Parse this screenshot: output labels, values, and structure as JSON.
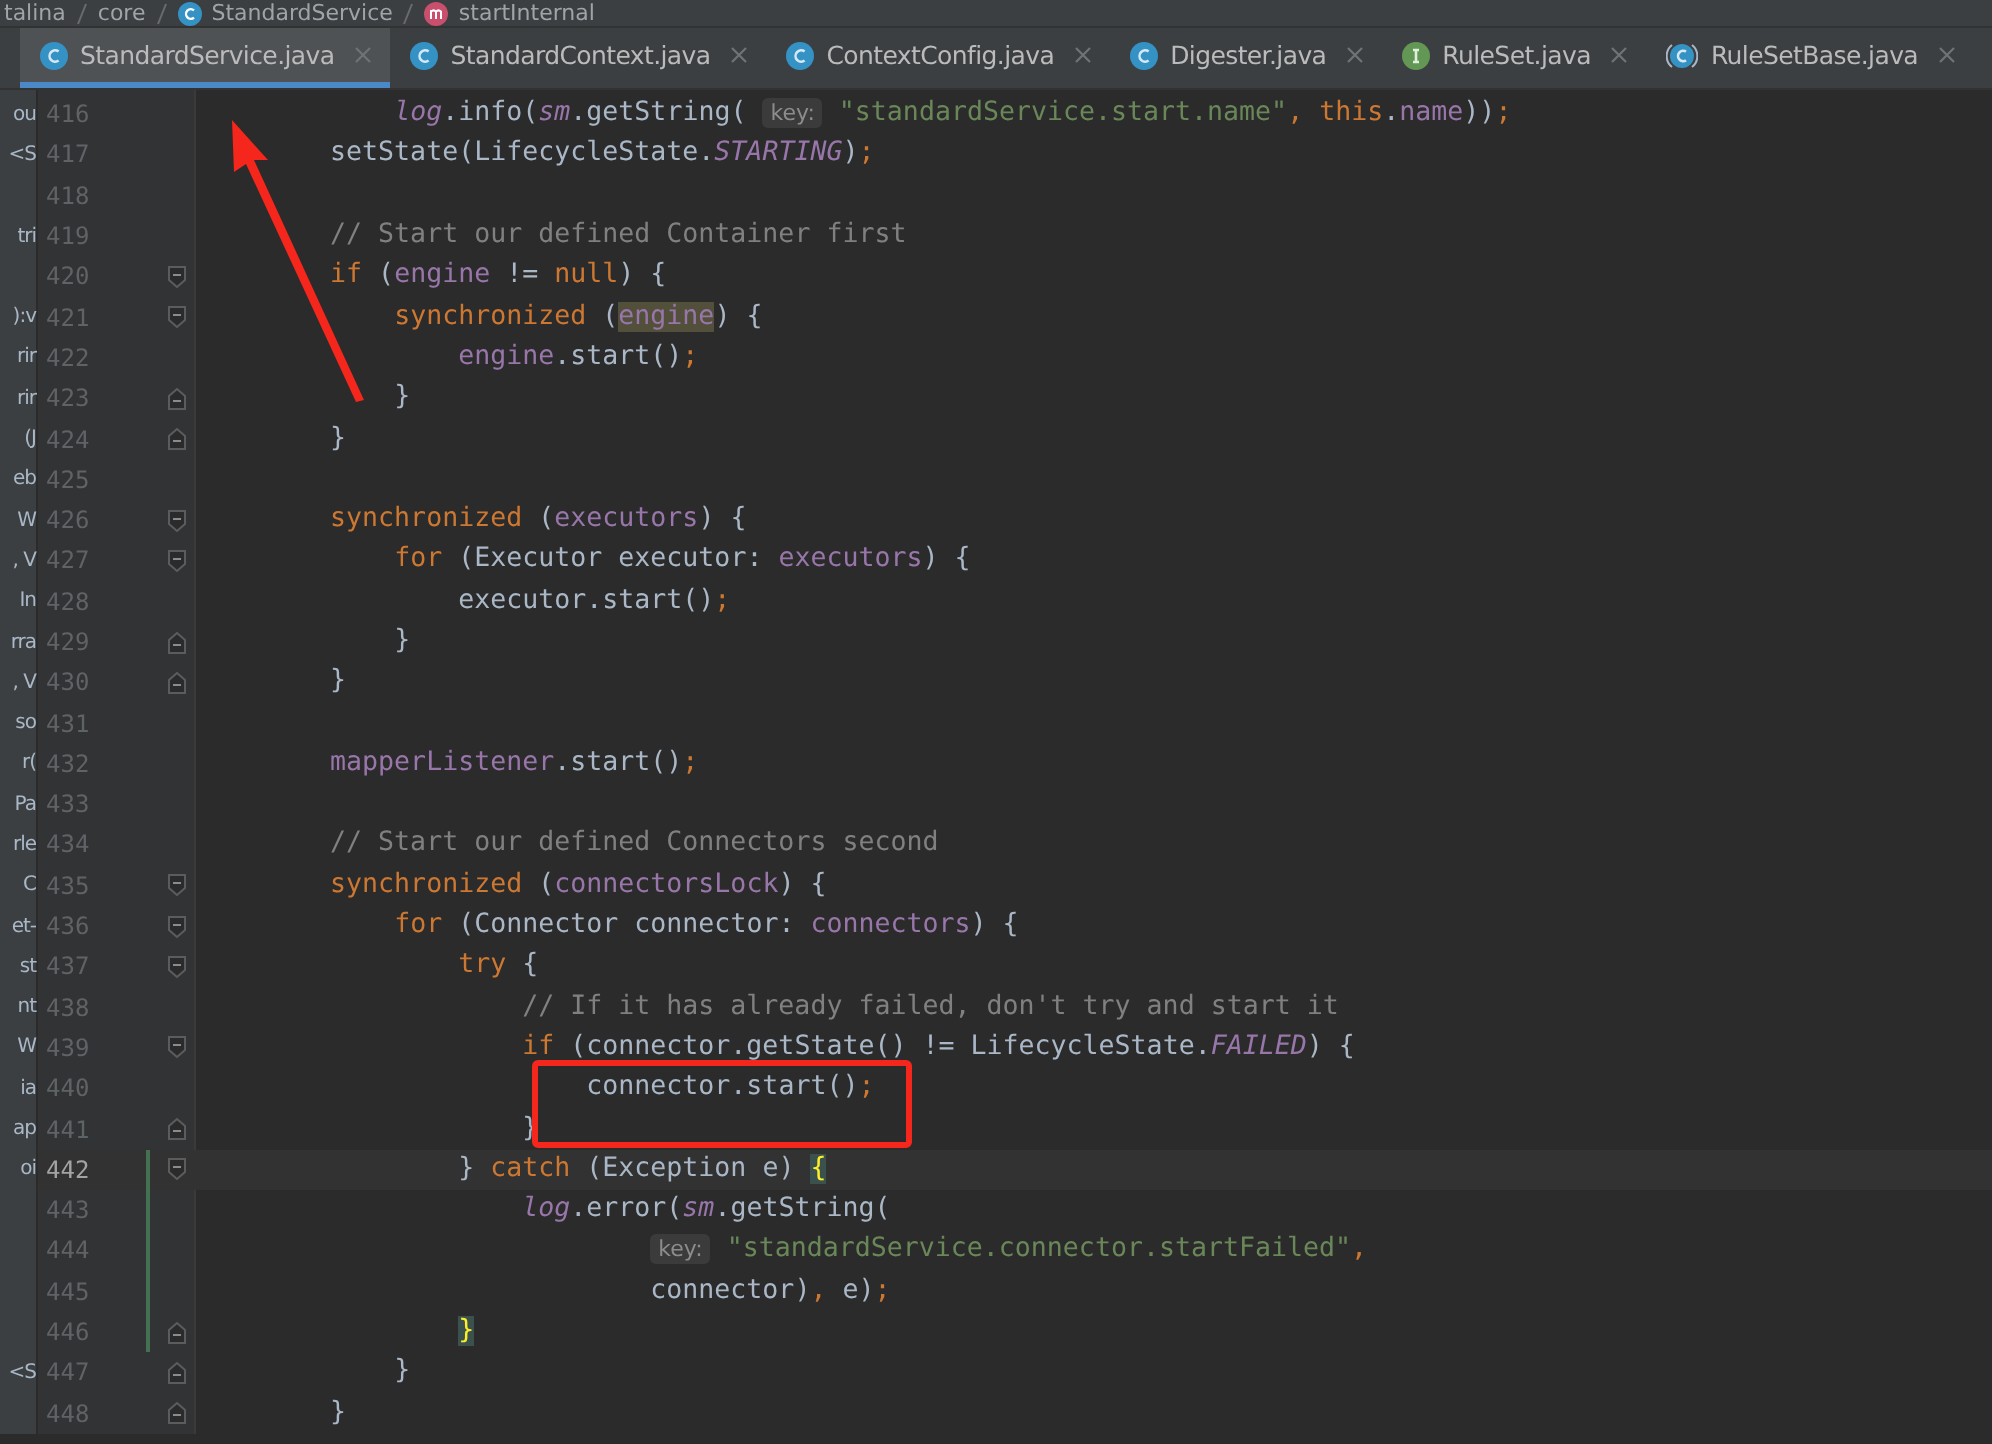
{
  "breadcrumb": [
    {
      "text": "talina",
      "kind": "package"
    },
    {
      "text": "core",
      "kind": "package"
    },
    {
      "text": "StandardService",
      "kind": "class"
    },
    {
      "text": "startInternal",
      "kind": "method"
    }
  ],
  "tabs": [
    {
      "label": "StandardService.java",
      "kind": "class",
      "selected": true
    },
    {
      "label": "StandardContext.java",
      "kind": "class",
      "selected": false
    },
    {
      "label": "ContextConfig.java",
      "kind": "class",
      "selected": false
    },
    {
      "label": "Digester.java",
      "kind": "class",
      "selected": false
    },
    {
      "label": "RuleSet.java",
      "kind": "interface",
      "selected": false
    },
    {
      "label": "RuleSetBase.java",
      "kind": "abstract",
      "selected": false
    }
  ],
  "project_panel": {
    "rows": [
      {
        "kind": "text",
        "text": "ou"
      },
      {
        "kind": "text",
        "text": "<S"
      },
      {
        "kind": "blank"
      },
      {
        "kind": "text",
        "text": "tri"
      },
      {
        "kind": "blank"
      },
      {
        "kind": "text",
        "text": "):v"
      },
      {
        "kind": "text",
        "text": "rir"
      },
      {
        "kind": "text",
        "text": "rir"
      },
      {
        "kind": "text",
        "text": "(J"
      },
      {
        "kind": "text",
        "text": "eb"
      },
      {
        "kind": "text",
        "text": "W"
      },
      {
        "kind": "text",
        "text": ", V"
      },
      {
        "kind": "text",
        "text": "In"
      },
      {
        "kind": "text",
        "text": "rra"
      },
      {
        "kind": "text",
        "text": ", V"
      },
      {
        "kind": "text",
        "text": "so"
      },
      {
        "kind": "text",
        "text": "r("
      },
      {
        "kind": "text",
        "text": "Pa"
      },
      {
        "kind": "text",
        "text": "rle"
      },
      {
        "kind": "text",
        "text": "C"
      },
      {
        "kind": "text",
        "text": "et-"
      },
      {
        "kind": "text",
        "text": "st"
      },
      {
        "kind": "text",
        "text": "nt"
      },
      {
        "kind": "text",
        "text": "W"
      },
      {
        "kind": "text",
        "text": "ia"
      },
      {
        "kind": "text",
        "text": "ap"
      },
      {
        "kind": "text",
        "text": "oi"
      },
      {
        "kind": "blank"
      },
      {
        "kind": "blank"
      },
      {
        "kind": "blank"
      },
      {
        "kind": "blank"
      },
      {
        "kind": "text",
        "text": "<S"
      }
    ]
  },
  "editor": {
    "lines": [
      {
        "children": [
          {
            "number": "416",
            "current": false,
            "changed": false,
            "fold_start": false,
            "fold_end": false,
            "tokens": [
              {
                "kind": "static",
                "text": "log"
              },
              {
                "kind": "plain",
                "text": ".info("
              },
              {
                "kind": "static",
                "text": "sm"
              },
              {
                "kind": "plain",
                "text": ".getString( "
              },
              {
                "kind": "hint",
                "text": "key:"
              },
              {
                "kind": "string",
                "text": " \"standardService.start.name\""
              },
              {
                "kind": "kw",
                "text": ", this"
              },
              {
                "kind": "plain",
                "text": "."
              },
              {
                "kind": "field",
                "text": "name"
              },
              {
                "kind": "plain",
                "text": "))"
              },
              {
                "kind": "kw",
                "text": ";"
              }
            ]
          }
        ]
      },
      {
        "number": "417",
        "current": false,
        "changed": false,
        "fold_start": false,
        "fold_end": false,
        "tokens": [
          {
            "kind": "plain",
            "text": "setState(LifecycleState."
          },
          {
            "kind": "const",
            "text": "STARTING"
          },
          {
            "kind": "plain",
            "text": ")"
          },
          {
            "kind": "kw",
            "text": ";"
          }
        ]
      },
      {
        "number": "418",
        "current": false,
        "changed": false,
        "fold_start": false,
        "fold_end": false
      },
      {
        "number": "419",
        "current": false,
        "changed": false,
        "fold_start": false,
        "fold_end": false,
        "tokens": [
          {
            "kind": "comment",
            "text": "// Start our defined Container first"
          }
        ]
      },
      {
        "number": "420",
        "current": false,
        "changed": false,
        "fold_start": true,
        "fold_end": false,
        "tokens": [
          {
            "kind": "kw",
            "text": "if"
          },
          {
            "kind": "plain",
            "text": " ("
          },
          {
            "kind": "field",
            "text": "engine"
          },
          {
            "kind": "plain",
            "text": " != "
          },
          {
            "kind": "kw",
            "text": "null"
          },
          {
            "kind": "plain",
            "text": ") {"
          }
        ],
        "children": [
          {
            "number": "421",
            "current": false,
            "changed": false,
            "fold_start": true,
            "fold_end": false,
            "tokens": [
              {
                "kind": "kw",
                "text": "synchronized"
              },
              {
                "kind": "plain",
                "text": " ("
              },
              {
                "kind": "usage",
                "text": "engine"
              },
              {
                "kind": "plain",
                "text": ") {"
              }
            ],
            "children": [
              {
                "number": "422",
                "current": false,
                "changed": false,
                "fold_start": false,
                "fold_end": false,
                "tokens": [
                  {
                    "kind": "field",
                    "text": "engine"
                  },
                  {
                    "kind": "plain",
                    "text": ".start()"
                  },
                  {
                    "kind": "kw",
                    "text": ";"
                  }
                ]
              }
            ]
          },
          {
            "number": "423",
            "current": false,
            "changed": false,
            "fold_start": false,
            "fold_end": true,
            "tokens": [
              {
                "kind": "plain",
                "text": "}"
              }
            ]
          }
        ]
      },
      {
        "number": "424",
        "current": false,
        "changed": false,
        "fold_start": false,
        "fold_end": true,
        "tokens": [
          {
            "kind": "plain",
            "text": "}"
          }
        ]
      },
      {
        "number": "425",
        "current": false,
        "changed": false,
        "fold_start": false,
        "fold_end": false
      },
      {
        "number": "426",
        "current": false,
        "changed": false,
        "fold_start": true,
        "fold_end": false,
        "tokens": [
          {
            "kind": "kw",
            "text": "synchronized"
          },
          {
            "kind": "plain",
            "text": " ("
          },
          {
            "kind": "field",
            "text": "executors"
          },
          {
            "kind": "plain",
            "text": ") {"
          }
        ],
        "children": [
          {
            "number": "427",
            "current": false,
            "changed": false,
            "fold_start": true,
            "fold_end": false,
            "tokens": [
              {
                "kind": "kw",
                "text": "for"
              },
              {
                "kind": "plain",
                "text": " (Executor executor: "
              },
              {
                "kind": "field",
                "text": "executors"
              },
              {
                "kind": "plain",
                "text": ") {"
              }
            ],
            "children": [
              {
                "number": "428",
                "current": false,
                "changed": false,
                "fold_start": false,
                "fold_end": false,
                "tokens": [
                  {
                    "kind": "plain",
                    "text": "executor.start()"
                  },
                  {
                    "kind": "kw",
                    "text": ";"
                  }
                ]
              }
            ]
          },
          {
            "number": "429",
            "current": false,
            "changed": false,
            "fold_start": false,
            "fold_end": true,
            "tokens": [
              {
                "kind": "plain",
                "text": "}"
              }
            ]
          }
        ]
      },
      {
        "number": "430",
        "current": false,
        "changed": false,
        "fold_start": false,
        "fold_end": true,
        "tokens": [
          {
            "kind": "plain",
            "text": "}"
          }
        ]
      },
      {
        "number": "431",
        "current": false,
        "changed": false,
        "fold_start": false,
        "fold_end": false
      },
      {
        "number": "432",
        "current": false,
        "changed": false,
        "fold_start": false,
        "fold_end": false,
        "tokens": [
          {
            "kind": "field",
            "text": "mapperListener"
          },
          {
            "kind": "plain",
            "text": ".start()"
          },
          {
            "kind": "kw",
            "text": ";"
          }
        ]
      },
      {
        "number": "433",
        "current": false,
        "changed": false,
        "fold_start": false,
        "fold_end": false
      },
      {
        "number": "434",
        "current": false,
        "changed": false,
        "fold_start": false,
        "fold_end": false,
        "tokens": [
          {
            "kind": "comment",
            "text": "// Start our defined Connectors second"
          }
        ]
      },
      {
        "number": "435",
        "current": false,
        "changed": false,
        "fold_start": true,
        "fold_end": false,
        "tokens": [
          {
            "kind": "kw",
            "text": "synchronized"
          },
          {
            "kind": "plain",
            "text": " ("
          },
          {
            "kind": "field",
            "text": "connectorsLock"
          },
          {
            "kind": "plain",
            "text": ") {"
          }
        ],
        "children": [
          {
            "number": "436",
            "current": false,
            "changed": false,
            "fold_start": true,
            "fold_end": false,
            "tokens": [
              {
                "kind": "kw",
                "text": "for"
              },
              {
                "kind": "plain",
                "text": " (Connector connector: "
              },
              {
                "kind": "field",
                "text": "connectors"
              },
              {
                "kind": "plain",
                "text": ") {"
              }
            ],
            "children": [
              {
                "number": "437",
                "current": false,
                "changed": false,
                "fold_start": true,
                "fold_end": false,
                "tokens": [
                  {
                    "kind": "kw",
                    "text": "try"
                  },
                  {
                    "kind": "plain",
                    "text": " {"
                  }
                ],
                "children": [
                  {
                    "number": "438",
                    "current": false,
                    "changed": false,
                    "fold_start": false,
                    "fold_end": false,
                    "tokens": [
                      {
                        "kind": "comment",
                        "text": "// If it has already failed, don't try and start it"
                      }
                    ]
                  },
                  {
                    "number": "439",
                    "current": false,
                    "changed": false,
                    "fold_start": true,
                    "fold_end": false,
                    "tokens": [
                      {
                        "kind": "kw",
                        "text": "if"
                      },
                      {
                        "kind": "plain",
                        "text": " (connector.getState() != LifecycleState."
                      },
                      {
                        "kind": "const",
                        "text": "FAILED"
                      },
                      {
                        "kind": "plain",
                        "text": ") {"
                      }
                    ],
                    "children": [
                      {
                        "number": "440",
                        "current": false,
                        "changed": false,
                        "fold_start": false,
                        "fold_end": false,
                        "tokens": [
                          {
                            "kind": "plain",
                            "text": "connector.start()"
                          },
                          {
                            "kind": "kw",
                            "text": ";"
                          }
                        ]
                      }
                    ]
                  },
                  {
                    "number": "441",
                    "current": false,
                    "changed": false,
                    "fold_start": false,
                    "fold_end": true,
                    "tokens": [
                      {
                        "kind": "plain",
                        "text": "}"
                      }
                    ]
                  }
                ]
              },
              {
                "number": "442",
                "current": true,
                "changed": true,
                "fold_start": true,
                "fold_end": false,
                "tokens": [
                  {
                    "kind": "plain",
                    "text": "} "
                  },
                  {
                    "kind": "kw",
                    "text": "catch"
                  },
                  {
                    "kind": "plain",
                    "text": " (Exception e) "
                  },
                  {
                    "kind": "match",
                    "text": "{"
                  }
                ],
                "children": [
                  {
                    "number": "443",
                    "current": false,
                    "changed": true,
                    "fold_start": false,
                    "fold_end": false,
                    "tokens": [
                      {
                        "kind": "static",
                        "text": "log"
                      },
                      {
                        "kind": "plain",
                        "text": ".error("
                      },
                      {
                        "kind": "static",
                        "text": "sm"
                      },
                      {
                        "kind": "plain",
                        "text": ".getString("
                      }
                    ],
                    "continuation": [
                      {
                        "number": "444",
                        "current": false,
                        "changed": true,
                        "fold_start": false,
                        "fold_end": false,
                        "tokens": [
                          {
                            "kind": "hint",
                            "text": "key:"
                          },
                          {
                            "kind": "string",
                            "text": " \"standardService.connector.startFailed\""
                          },
                          {
                            "kind": "kw",
                            "text": ","
                          }
                        ]
                      },
                      {
                        "number": "445",
                        "current": false,
                        "changed": true,
                        "fold_start": false,
                        "fold_end": false,
                        "tokens": [
                          {
                            "kind": "plain",
                            "text": "connector)"
                          },
                          {
                            "kind": "kw",
                            "text": ","
                          },
                          {
                            "kind": "plain",
                            "text": " e)"
                          },
                          {
                            "kind": "kw",
                            "text": ";"
                          }
                        ]
                      }
                    ]
                  }
                ]
              },
              {
                "number": "446",
                "current": false,
                "changed": true,
                "fold_start": false,
                "fold_end": true,
                "tokens": [
                  {
                    "kind": "match",
                    "text": "}"
                  }
                ]
              }
            ]
          },
          {
            "number": "447",
            "current": false,
            "changed": false,
            "fold_start": false,
            "fold_end": true,
            "tokens": [
              {
                "kind": "plain",
                "text": "}"
              }
            ]
          }
        ]
      },
      {
        "number": "448",
        "current": false,
        "changed": false,
        "fold_start": false,
        "fold_end": true,
        "tokens": [
          {
            "kind": "plain",
            "text": "}"
          }
        ]
      }
    ]
  }
}
